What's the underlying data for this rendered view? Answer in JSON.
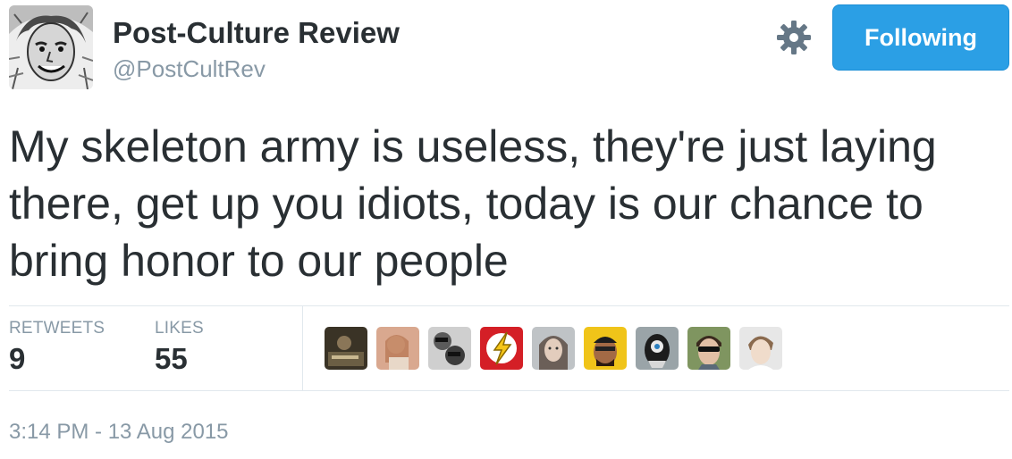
{
  "user": {
    "display_name": "Post-Culture Review",
    "handle": "@PostCultRev",
    "avatar_icon": "profile-avatar"
  },
  "actions": {
    "settings_icon": "gear-icon",
    "follow_label": "Following",
    "follow_color": "#2b9fe5"
  },
  "tweet": {
    "text": "My skeleton army is useless, they're just laying there, get up you idiots, today is our chance to bring honor to our people"
  },
  "stats": {
    "retweets_label": "RETWEETS",
    "retweets_count": "9",
    "likes_label": "LIKES",
    "likes_count": "55"
  },
  "likers": [
    {
      "icon": "liker-avatar-1"
    },
    {
      "icon": "liker-avatar-2"
    },
    {
      "icon": "liker-avatar-3"
    },
    {
      "icon": "liker-avatar-4"
    },
    {
      "icon": "liker-avatar-5"
    },
    {
      "icon": "liker-avatar-6"
    },
    {
      "icon": "liker-avatar-7"
    },
    {
      "icon": "liker-avatar-8"
    },
    {
      "icon": "liker-avatar-9"
    }
  ],
  "timestamp": "3:14 PM - 13 Aug 2015"
}
